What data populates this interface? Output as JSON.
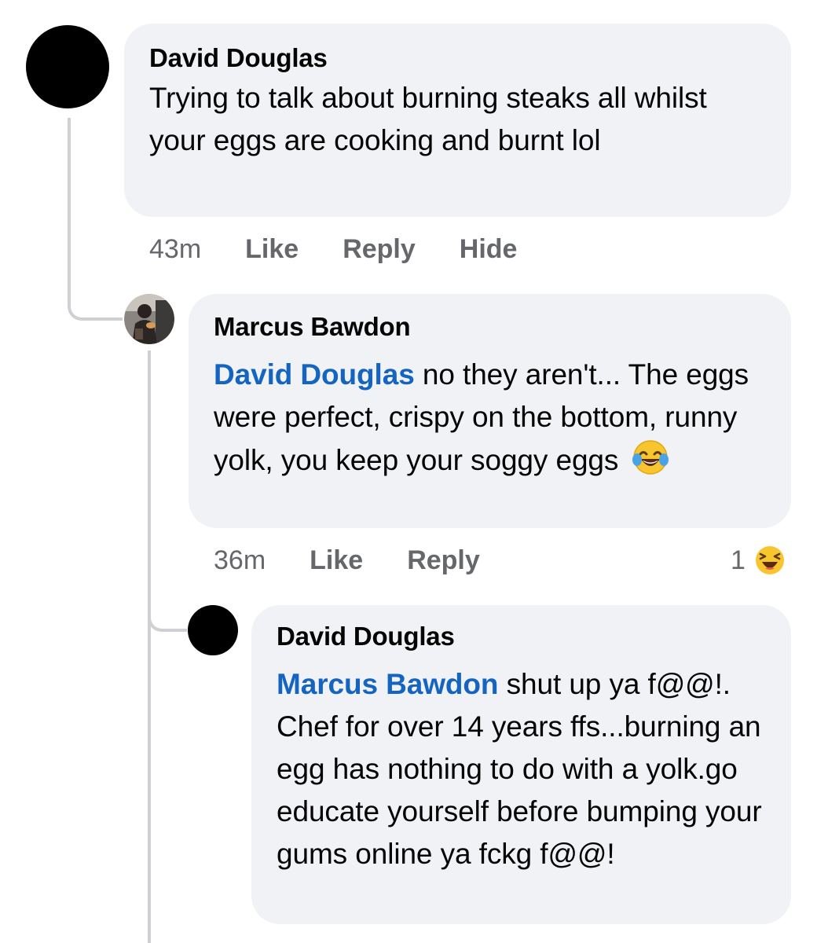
{
  "comments": [
    {
      "author": "David Douglas",
      "text": "Trying to talk about burning steaks all whilst your eggs are cooking and burnt lol",
      "time": "43m",
      "like_label": "Like",
      "reply_label": "Reply",
      "hide_label": "Hide"
    },
    {
      "author": "Marcus Bawdon",
      "mention": "David Douglas",
      "text": "no they aren't... The eggs were perfect, crispy on the bottom, runny yolk, you keep your soggy eggs",
      "emoji": "face-with-tears-of-joy-icon",
      "time": "36m",
      "like_label": "Like",
      "reply_label": "Reply",
      "reaction_count": "1",
      "reaction_icon": "laughing-reaction-icon"
    },
    {
      "author": "David Douglas",
      "mention": "Marcus Bawdon",
      "text": "shut up ya f@@!. Chef for over 14 years ffs...burning an egg has nothing to do with a yolk.go educate yourself before bumping your gums online ya fckg f@@!"
    }
  ],
  "colors": {
    "bubble": "#f0f2f5",
    "mention": "#1565c0",
    "meta": "#65676b",
    "thread_line": "#ced0d4"
  }
}
